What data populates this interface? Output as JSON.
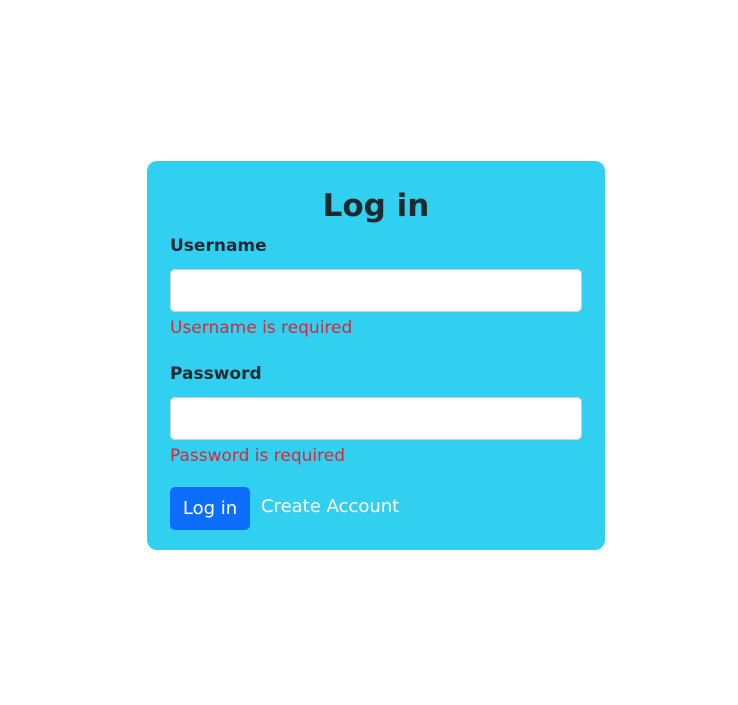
{
  "form": {
    "title": "Log in",
    "username": {
      "label": "Username",
      "value": "",
      "placeholder": "",
      "error": "Username is required"
    },
    "password": {
      "label": "Password",
      "value": "",
      "placeholder": "",
      "error": "Password is required"
    },
    "submit_label": "Log in",
    "create_account_label": "Create Account"
  },
  "colors": {
    "card_background": "#32d0f0",
    "primary_button": "#0d6efd",
    "error_text": "#d62839",
    "heading_text": "#1f2a30"
  }
}
